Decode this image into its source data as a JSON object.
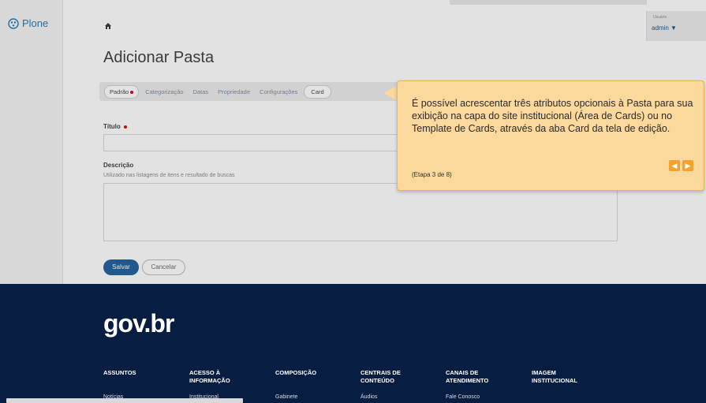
{
  "brand": {
    "plone_label": "Plone"
  },
  "header": {
    "user_label": "Usuário",
    "user_name": "admin ▼"
  },
  "page": {
    "title": "Adicionar Pasta"
  },
  "tabs": [
    {
      "label": "Padrão"
    },
    {
      "label": "Categorização"
    },
    {
      "label": "Datas"
    },
    {
      "label": "Propriedade"
    },
    {
      "label": "Configurações"
    },
    {
      "label": "Card"
    }
  ],
  "form": {
    "title_label": "Título",
    "description_label": "Descrição",
    "description_help": "Utilizado nas listagens de itens e resultado de buscas",
    "save_label": "Salvar",
    "cancel_label": "Cancelar"
  },
  "tooltip": {
    "text": "É possível acrescentar três atributos opcionais à Pasta para sua exibição na capa do site institucional (Área de Cards) ou no Template de Cards, através da aba Card da tela de edição.",
    "step": "(Etapa 3 de 8)",
    "prev_icon": "◀",
    "next_icon": "▶"
  },
  "footer": {
    "logo": "gov.br",
    "columns": [
      {
        "title": "ASSUNTOS",
        "sub": "Notícias"
      },
      {
        "title": "ACESSO À INFORMAÇÃO",
        "sub": "Institucional"
      },
      {
        "title": "COMPOSIÇÃO",
        "sub": "Gabinete"
      },
      {
        "title": "CENTRAIS DE CONTEÚDO",
        "sub": "Áudios"
      },
      {
        "title": "CANAIS DE ATENDIMENTO",
        "sub": "Fale Conosco"
      },
      {
        "title": "IMAGEM INSTITUCIONAL",
        "sub": ""
      }
    ]
  },
  "colors": {
    "footer_bg": "#071d41",
    "tooltip_bg": "#fbd89c",
    "primary": "#1d5f9e",
    "required": "#d0021b"
  }
}
